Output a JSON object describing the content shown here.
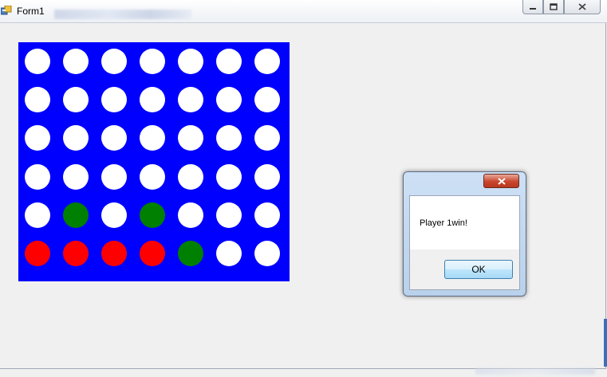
{
  "window": {
    "title": "Form1",
    "icon": "form-app-icon",
    "caption_buttons": [
      "minimize-icon",
      "restore-icon",
      "close-icon"
    ]
  },
  "board": {
    "rows": 6,
    "columns": 7,
    "background_color": "#0000ff",
    "piece_colors": {
      "empty": "#ffffff",
      "player1": "#ff0000",
      "player2": "#008000"
    },
    "cells": [
      [
        "empty",
        "empty",
        "empty",
        "empty",
        "empty",
        "empty",
        "empty"
      ],
      [
        "empty",
        "empty",
        "empty",
        "empty",
        "empty",
        "empty",
        "empty"
      ],
      [
        "empty",
        "empty",
        "empty",
        "empty",
        "empty",
        "empty",
        "empty"
      ],
      [
        "empty",
        "empty",
        "empty",
        "empty",
        "empty",
        "empty",
        "empty"
      ],
      [
        "empty",
        "player2",
        "empty",
        "player2",
        "empty",
        "empty",
        "empty"
      ],
      [
        "player1",
        "player1",
        "player1",
        "player1",
        "player2",
        "empty",
        "empty"
      ]
    ]
  },
  "message_box": {
    "text": "Player 1win!",
    "ok_label": "OK",
    "close_icon": "close-icon"
  }
}
